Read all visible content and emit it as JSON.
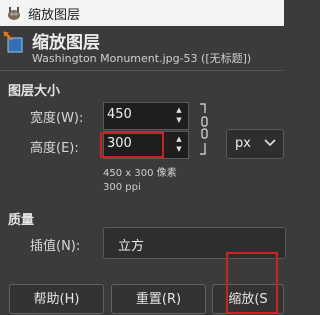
{
  "window": {
    "title": "缩放图层"
  },
  "header": {
    "title": "缩放图层",
    "subtitle": "Washington Monument.jpg-53 ([无标题])"
  },
  "layer_size": {
    "section_label": "图层大小",
    "width_label": "宽度(W):",
    "width_value": "450",
    "height_label": "高度(E):",
    "height_value": "300",
    "unit": "px",
    "info_size": "450 x 300 像素",
    "info_resolution": "300 ppi"
  },
  "quality": {
    "section_label": "质量",
    "interpolation_label": "插值(N):",
    "interpolation_value": "立方"
  },
  "buttons": {
    "help": "帮助(H)",
    "reset": "重置(R)",
    "scale": "缩放(S"
  },
  "colors": {
    "highlight": "#d21f26",
    "background": "#3b3b3b"
  }
}
